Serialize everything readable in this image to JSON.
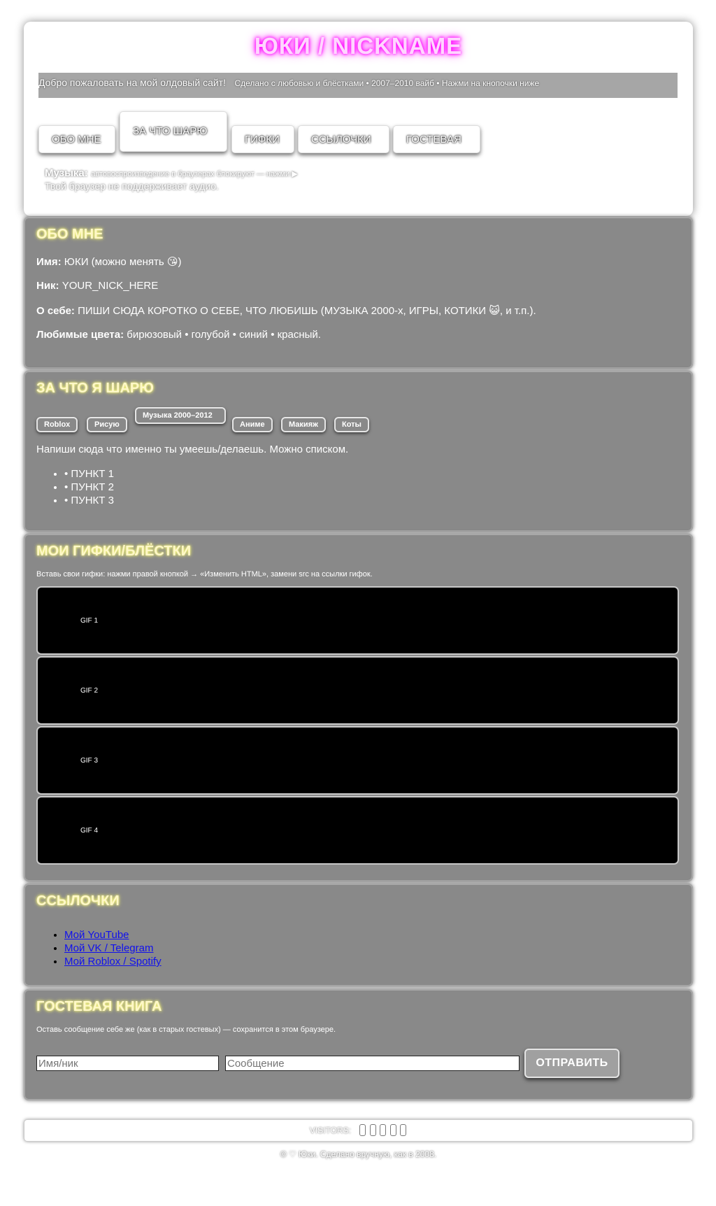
{
  "header": {
    "title": "ЮКИ / NICKNAME",
    "marquee_main": "Добро пожаловать на мой олдовый сайт!",
    "marquee_sub": "Сделано с любовью и блёстками • 2007–2010 вайб • Нажми на кнопочки ниже",
    "nav": [
      "ОБО МНЕ",
      "ЗА ЧТО ШАРЮ",
      "ГИФКИ",
      "ССЫЛОЧКИ",
      "ГОСТЕВАЯ"
    ],
    "music_label": "Музыка:",
    "music_hint": "автовоспроизведение в браузерах блокируют — нажми ▶",
    "no_audio": "Твой браузер не поддерживает аудио."
  },
  "about": {
    "title": "ОБО МНЕ",
    "name_label": "Имя:",
    "name_value": "ЮКИ (можно менять 😘)",
    "nick_label": "Ник:",
    "nick_value": "YOUR_NICK_HERE",
    "self_label": "О себе:",
    "self_value": "ПИШИ СЮДА КОРОТКО О СЕБЕ, ЧТО ЛЮБИШЬ (МУЗЫКА 2000-х, ИГРЫ, КОТИКИ 😺, и т.п.).",
    "colors_label": "Любимые цвета:",
    "colors_value": "бирюзовый • голубой • синий • красный."
  },
  "skills": {
    "title": "ЗА ЧТО Я ШАРЮ",
    "tags": [
      "Roblox",
      "Рисую",
      "Музыка 2000–2012",
      "Аниме",
      "Макияж",
      "Коты"
    ],
    "intro": "Напиши сюда что именно ты умеешь/делаешь. Можно списком.",
    "items": [
      "• ПУНКТ 1",
      "• ПУНКТ 2",
      "• ПУНКТ 3"
    ]
  },
  "gifs": {
    "title": "МОИ ГИФКИ/БЛЁСТКИ",
    "hint": "Вставь свои гифки: нажми правой кнопкой → «Изменить HTML», замени src на ссылки гифок.",
    "items": [
      "GIF 1",
      "GIF 2",
      "GIF 3",
      "GIF 4"
    ]
  },
  "links": {
    "title": "ССЫЛОЧКИ",
    "items": [
      "Мой YouTube",
      "Мой VK / Telegram",
      "Мой Roblox / Spotify"
    ]
  },
  "guestbook": {
    "title": "ГОСТЕВАЯ КНИГА",
    "hint": "Оставь сообщение себе же (как в старых гостевых) — сохранится в этом браузере.",
    "name_placeholder": "Имя/ник",
    "message_placeholder": "Сообщение",
    "send_label": "ОТПРАВИТЬ"
  },
  "footer": {
    "visitors_label": "VISITORS:",
    "copyright": "© ♡ Юки. Сделано вручную, как в 2008."
  }
}
